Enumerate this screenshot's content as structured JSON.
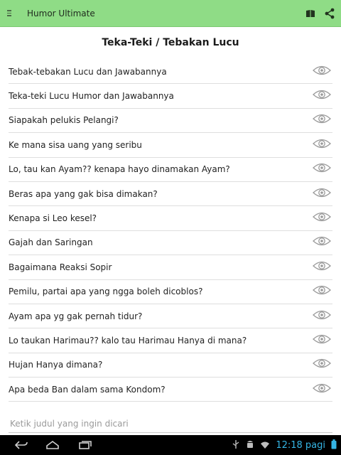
{
  "app": {
    "title": "Humor Ultimate"
  },
  "page": {
    "title": "Teka-Teki / Tebakan Lucu"
  },
  "items": [
    {
      "label": "Tebak-tebakan Lucu dan Jawabannya"
    },
    {
      "label": "Teka-teki Lucu Humor dan Jawabannya"
    },
    {
      "label": "Siapakah pelukis Pelangi?"
    },
    {
      "label": "Ke mana sisa uang yang seribu"
    },
    {
      "label": "Lo, tau kan Ayam?? kenapa hayo dinamakan Ayam?"
    },
    {
      "label": "Beras apa yang gak bisa dimakan?"
    },
    {
      "label": "Kenapa si Leo kesel?"
    },
    {
      "label": "Gajah dan Saringan"
    },
    {
      "label": "Bagaimana Reaksi Sopir"
    },
    {
      "label": "Pemilu, partai apa yang ngga boleh dicoblos?"
    },
    {
      "label": "Ayam apa yg gak pernah tidur?"
    },
    {
      "label": "Lo taukan Harimau?? kalo tau Harimau Hanya di mana?"
    },
    {
      "label": "Hujan Hanya dimana?"
    },
    {
      "label": "Apa beda Ban dalam sama Kondom?"
    }
  ],
  "search": {
    "placeholder": "Ketik judul yang ingin dicari",
    "value": ""
  },
  "status_bar": {
    "time": "12:18 pagi"
  },
  "icons": {
    "menu": "menu-icon",
    "book": "book-icon",
    "share": "share-icon",
    "eye": "eye-icon",
    "back": "back-icon",
    "home": "home-icon",
    "recents": "recents-icon",
    "usb": "usb-icon",
    "android": "android-icon",
    "wifi": "wifi-icon",
    "battery": "battery-icon"
  },
  "colors": {
    "appbar": "#8fdc86",
    "clock": "#35b5e5",
    "eye": "#9a9a9a"
  }
}
